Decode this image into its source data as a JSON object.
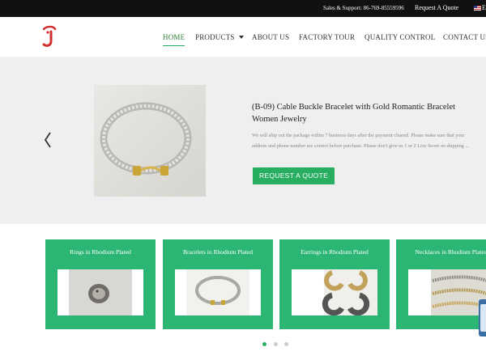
{
  "topbar": {
    "support": "Sales & Support: 86-769-85559596",
    "request_quote": "Request A Quote",
    "language": "E"
  },
  "nav": {
    "items": [
      {
        "label": "HOME",
        "active": true
      },
      {
        "label": "PRODUCTS",
        "dropdown": true
      },
      {
        "label": "ABOUT US"
      },
      {
        "label": "FACTORY TOUR"
      },
      {
        "label": "QUALITY CONTROL"
      },
      {
        "label": "CONTACT US"
      }
    ]
  },
  "hero": {
    "title": "(B-09) Cable Buckle Bracelet with Gold Romantic Bracelet Women Jewelry",
    "description": "We will ship out the package within 7 business days after the payment cleared. Please make sure that your address and phone number are correct before purchase. Please don't give us 1 or 2 Low Score on shipping ...",
    "button": "REQUEST A QUOTE",
    "prev_icon": "chevron-left-icon"
  },
  "categories": [
    {
      "title": "Rings in Rhodium Plated"
    },
    {
      "title": "Bracelets in Rhodium Plated"
    },
    {
      "title": "Earrings in Rhodium Plated"
    },
    {
      "title": "Necklaces in Rhodium Plated"
    }
  ],
  "pagination": {
    "count": 3,
    "active": 1
  },
  "colors": {
    "accent": "#27ae60",
    "card": "#2bb673",
    "topbar": "#111111",
    "logo": "#d32f2f"
  }
}
